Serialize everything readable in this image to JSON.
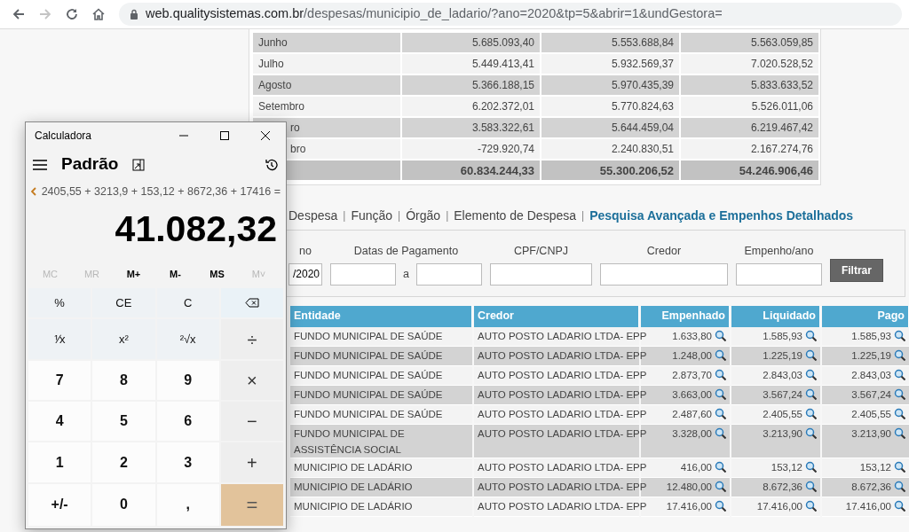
{
  "browser": {
    "url_host": "web.qualitysistemas.com.br",
    "url_path": "/despesas/municipio_de_ladario/?ano=2020&tp=5&abrir=1&undGestora="
  },
  "monthly_table": {
    "rows": [
      {
        "label": "Junho",
        "covered": false,
        "values": [
          "5.685.093,40",
          "5.553.688,84",
          "5.563.059,85"
        ]
      },
      {
        "label": "Julho",
        "covered": false,
        "values": [
          "5.449.413,41",
          "5.932.569,37",
          "7.020.528,52"
        ]
      },
      {
        "label": "Agosto",
        "covered": false,
        "values": [
          "5.366.188,15",
          "5.970.435,39",
          "5.833.633,52"
        ]
      },
      {
        "label": "Setembro",
        "covered": false,
        "values": [
          "6.202.372,01",
          "5.770.824,63",
          "5.526.011,06"
        ]
      },
      {
        "label": "ro",
        "covered": true,
        "values": [
          "3.583.322,61",
          "5.644.459,04",
          "6.219.467,42"
        ]
      },
      {
        "label": "bro",
        "covered": true,
        "values": [
          "-729.920,74",
          "2.240.830,51",
          "2.167.274,76"
        ]
      }
    ],
    "total": [
      "60.834.244,33",
      "55.300.206,52",
      "54.246.906,46"
    ]
  },
  "nav_links": [
    {
      "label": "Despesa",
      "selected": false
    },
    {
      "label": "Função",
      "selected": false
    },
    {
      "label": "Órgão",
      "selected": false
    },
    {
      "label": "Elemento de Despesa",
      "selected": false
    },
    {
      "label": "Pesquisa Avançada e Empenhos Detalhados",
      "selected": true
    }
  ],
  "nav_separator": "|",
  "filter": {
    "fields": [
      {
        "label": "no",
        "value": "/2020"
      },
      {
        "label": "Datas de Pagamento",
        "joiner": "a"
      },
      {
        "label": "CPF/CNPJ"
      },
      {
        "label": "Credor"
      },
      {
        "label": "Empenho/ano"
      }
    ],
    "button": "Filtrar"
  },
  "results_table": {
    "columns": [
      "Entidade",
      "Credor",
      "Empenhado",
      "Liquidado",
      "Pago"
    ],
    "rows": [
      [
        "FUNDO MUNICIPAL DE SAÚDE",
        "AUTO POSTO LADARIO LTDA- EPP",
        "1.633,80",
        "1.585,93",
        "1.585,93"
      ],
      [
        "FUNDO MUNICIPAL DE SAÚDE",
        "AUTO POSTO LADARIO LTDA- EPP",
        "1.248,00",
        "1.225,19",
        "1.225,19"
      ],
      [
        "FUNDO MUNICIPAL DE SAÚDE",
        "AUTO POSTO LADARIO LTDA- EPP",
        "2.873,70",
        "2.843,03",
        "2.843,03"
      ],
      [
        "FUNDO MUNICIPAL DE SAÚDE",
        "AUTO POSTO LADARIO LTDA- EPP",
        "3.663,00",
        "3.567,24",
        "3.567,24"
      ],
      [
        "FUNDO MUNICIPAL DE SAÚDE",
        "AUTO POSTO LADARIO LTDA- EPP",
        "2.487,60",
        "2.405,55",
        "2.405,55"
      ],
      [
        "FUNDO MUNICIPAL DE ASSISTÊNCIA SOCIAL",
        "AUTO POSTO LADARIO LTDA- EPP",
        "3.328,00",
        "3.213,90",
        "3.213,90"
      ],
      [
        "MUNICIPIO DE LADÁRIO",
        "AUTO POSTO LADARIO LTDA- EPP",
        "416,00",
        "153,12",
        "153,12"
      ],
      [
        "MUNICIPIO DE LADÁRIO",
        "AUTO POSTO LADARIO LTDA- EPP",
        "12.480,00",
        "8.672,36",
        "8.672,36"
      ],
      [
        "MUNICIPIO DE LADÁRIO",
        "AUTO POSTO LADARIO LTDA- EPP",
        "17.416,00",
        "17.416,00",
        "17.416,00"
      ]
    ]
  },
  "calculator": {
    "title": "Calculadora",
    "mode": "Padrão",
    "expression": "2405,55 + 3213,9 + 153,12 + 8672,36 + 17416 =",
    "result": "41.082,32",
    "memory": [
      {
        "label": "MC",
        "disabled": true
      },
      {
        "label": "MR",
        "disabled": true
      },
      {
        "label": "M+",
        "disabled": false
      },
      {
        "label": "M-",
        "disabled": false
      },
      {
        "label": "MS",
        "disabled": false
      },
      {
        "label": "M˅",
        "disabled": true
      }
    ],
    "keys": [
      {
        "kind": "function",
        "label": "%"
      },
      {
        "kind": "function",
        "label": "CE"
      },
      {
        "kind": "function",
        "label": "C"
      },
      {
        "kind": "backspace"
      },
      {
        "kind": "function",
        "label": "⅟x"
      },
      {
        "kind": "function",
        "label": "x²"
      },
      {
        "kind": "function",
        "label": "²√x"
      },
      {
        "kind": "operator",
        "label": "÷"
      },
      {
        "kind": "digit",
        "label": "7"
      },
      {
        "kind": "digit",
        "label": "8"
      },
      {
        "kind": "digit",
        "label": "9"
      },
      {
        "kind": "operator",
        "label": "×"
      },
      {
        "kind": "digit",
        "label": "4"
      },
      {
        "kind": "digit",
        "label": "5"
      },
      {
        "kind": "digit",
        "label": "6"
      },
      {
        "kind": "operator",
        "label": "−"
      },
      {
        "kind": "digit",
        "label": "1"
      },
      {
        "kind": "digit",
        "label": "2"
      },
      {
        "kind": "digit",
        "label": "3"
      },
      {
        "kind": "operator",
        "label": "+"
      },
      {
        "kind": "digit",
        "label": "+/-"
      },
      {
        "kind": "digit",
        "label": "0"
      },
      {
        "kind": "digit",
        "label": ","
      },
      {
        "kind": "equals",
        "label": "="
      }
    ]
  }
}
